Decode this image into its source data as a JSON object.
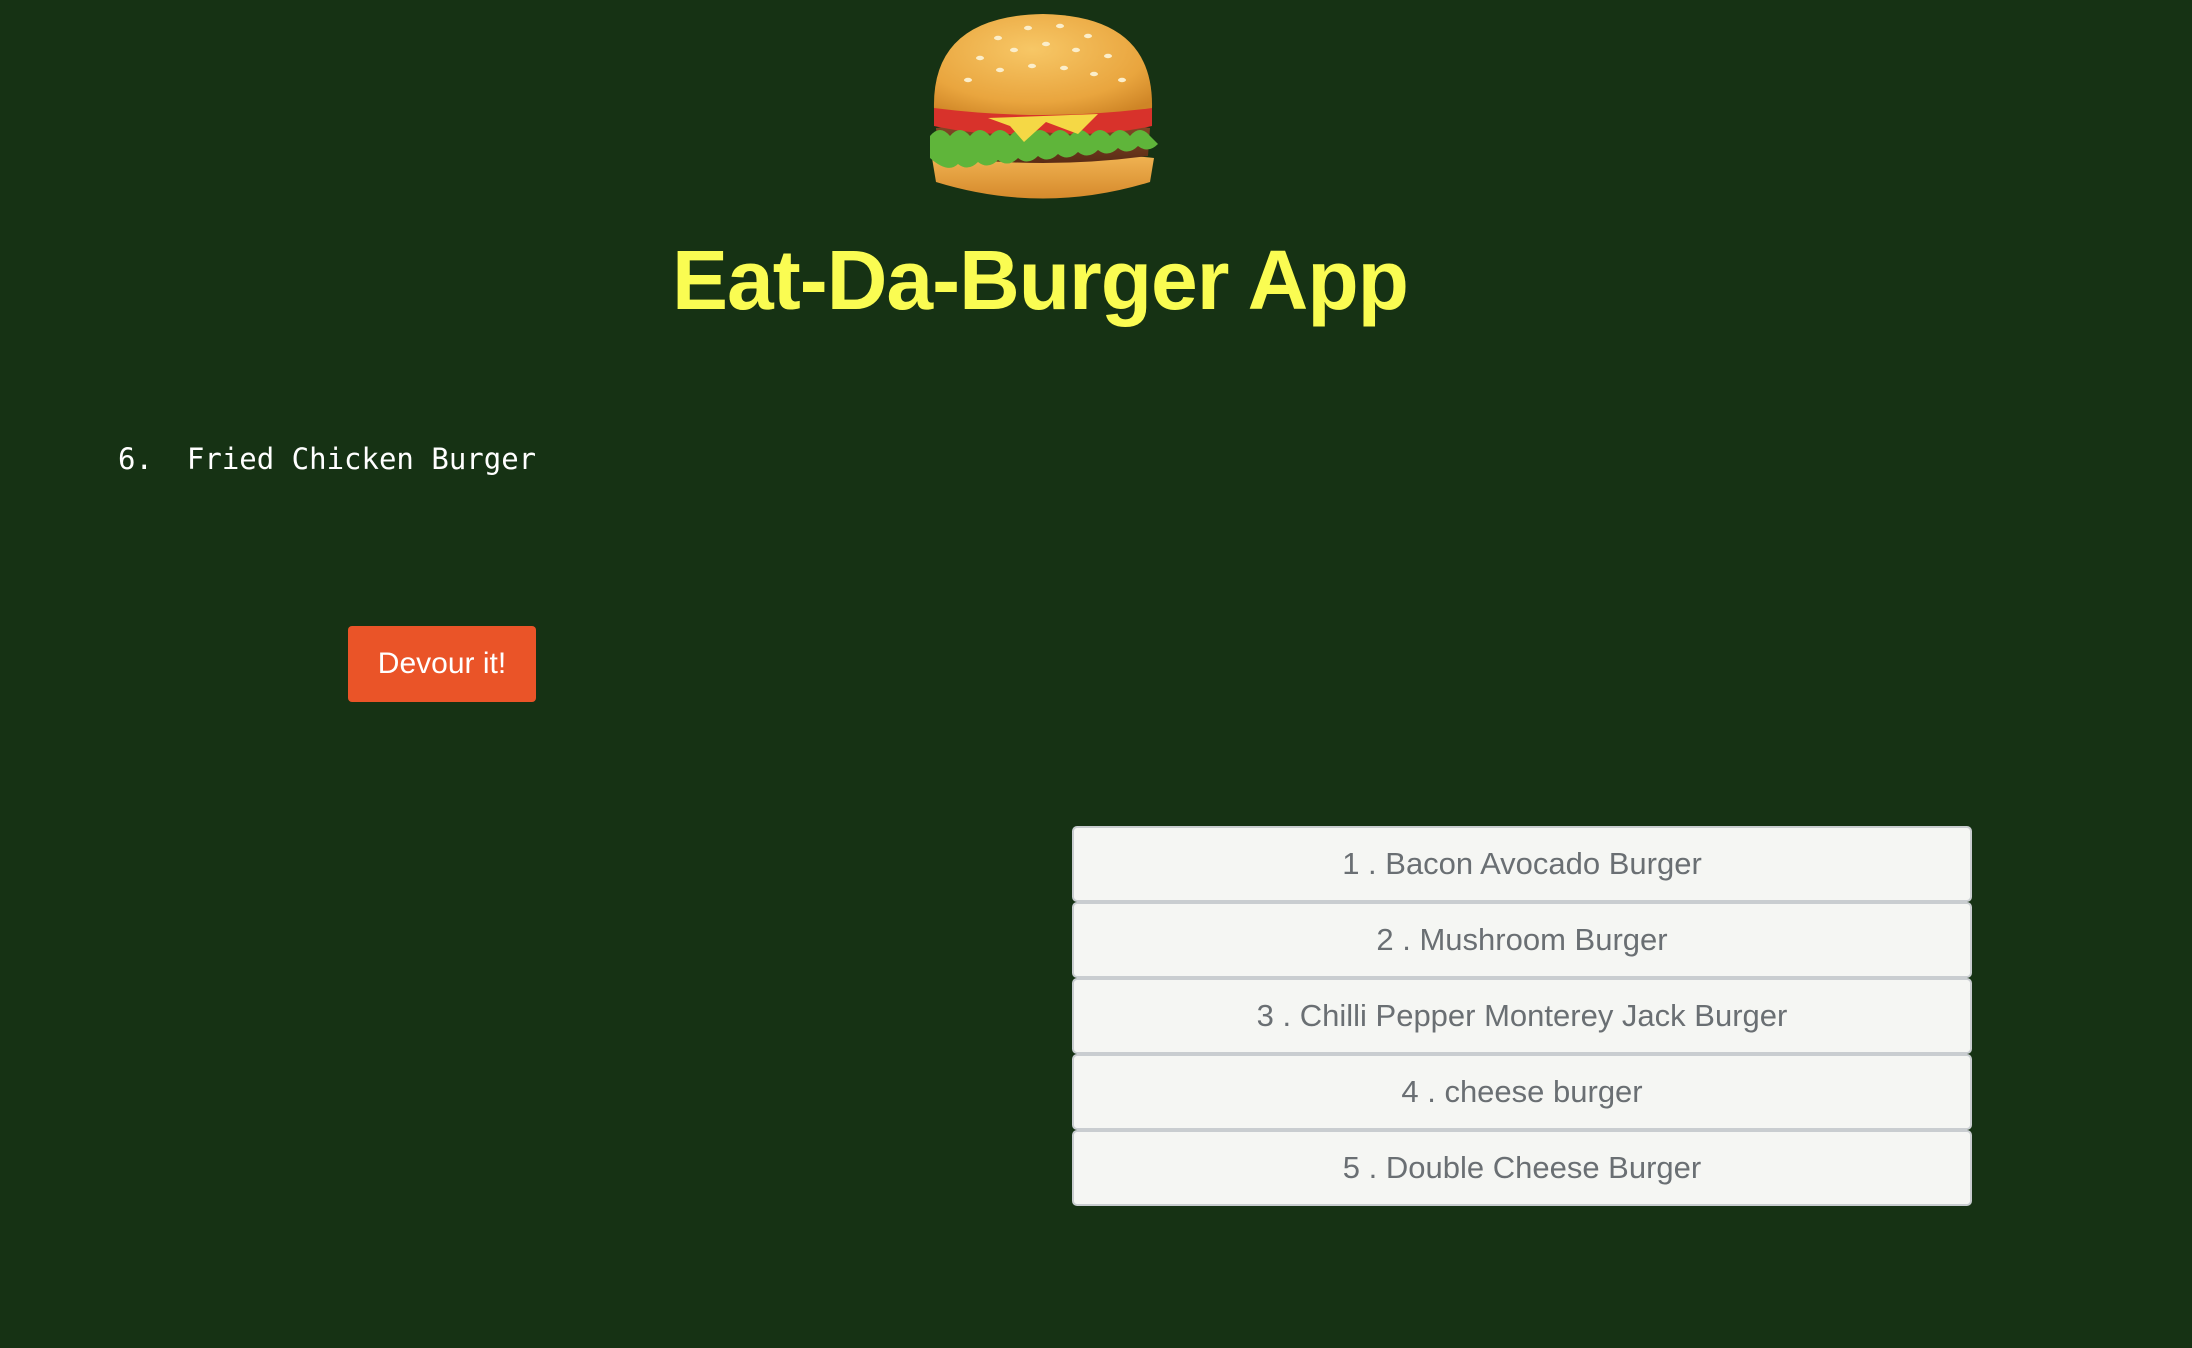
{
  "header": {
    "logo_icon": "hamburger-icon",
    "title": "Eat-Da-Burger App",
    "title_color": "#fafc52",
    "background_color": "#163214"
  },
  "pending": {
    "items": [
      {
        "number": "6.",
        "name": "Fried Chicken Burger"
      }
    ],
    "devour_label": "Devour it!",
    "button_color": "#ea5428"
  },
  "devoured": {
    "items": [
      {
        "label": "1 . Bacon Avocado Burger"
      },
      {
        "label": "2 . Mushroom Burger"
      },
      {
        "label": "3 . Chilli Pepper Monterey Jack Burger"
      },
      {
        "label": "4 . cheese burger"
      },
      {
        "label": "5 . Double Cheese Burger"
      }
    ]
  }
}
